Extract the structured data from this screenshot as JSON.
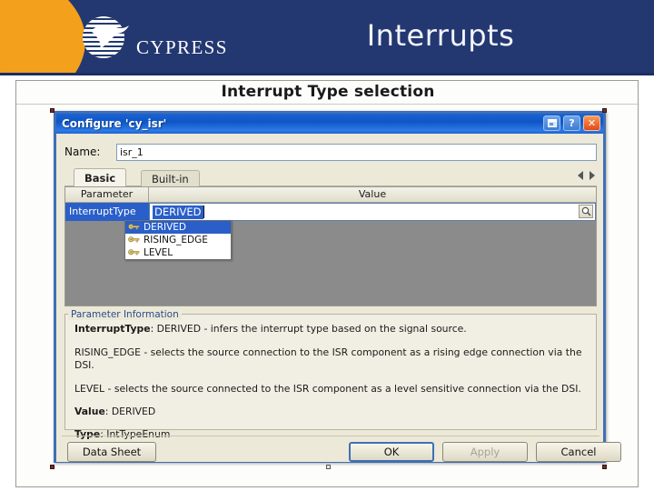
{
  "slide": {
    "title": "Interrupts",
    "subtitle": "Interrupt Type selection",
    "brand_name": "CYPRESS",
    "colors": {
      "banner_blue": "#233871",
      "brand_orange": "#F3A01C",
      "selection_blue": "#2a5fc9",
      "dialog_face": "#ece9d8"
    }
  },
  "dialog": {
    "title": "Configure 'cy_isr'",
    "titlebar_buttons": [
      {
        "name": "restore",
        "glyph": "❐"
      },
      {
        "name": "help",
        "glyph": "?"
      },
      {
        "name": "close",
        "glyph": "✕"
      }
    ],
    "name_field": {
      "label": "Name:",
      "value": "isr_1",
      "placeholder": ""
    },
    "tabs": [
      {
        "label": "Basic",
        "active": true
      },
      {
        "label": "Built-in",
        "active": false
      }
    ],
    "grid": {
      "headers": [
        "Parameter",
        "Value"
      ],
      "rows": [
        {
          "parameter": "InterruptType",
          "value": "DERIVED"
        }
      ]
    },
    "dropdown": {
      "open": true,
      "items": [
        {
          "label": "DERIVED",
          "selected": true
        },
        {
          "label": "RISING_EDGE",
          "selected": false
        },
        {
          "label": "LEVEL",
          "selected": false
        }
      ]
    },
    "parameter_information": {
      "legend": "Parameter Information",
      "line1_bold": "InterruptType",
      "line1_rest": ": DERIVED - infers the interrupt type based on the signal source.",
      "line2": "RISING_EDGE - selects the source connection to the ISR component as a rising edge connection via the DSI.",
      "line3": "LEVEL - selects the source connected to the ISR component as a level sensitive connection via the DSI.",
      "value_label": "Value",
      "value_text": ": DERIVED",
      "type_label": "Type",
      "type_text": ": IntTypeEnum"
    },
    "buttons": {
      "data_sheet": "Data Sheet",
      "ok": "OK",
      "apply": "Apply",
      "cancel": "Cancel"
    }
  }
}
